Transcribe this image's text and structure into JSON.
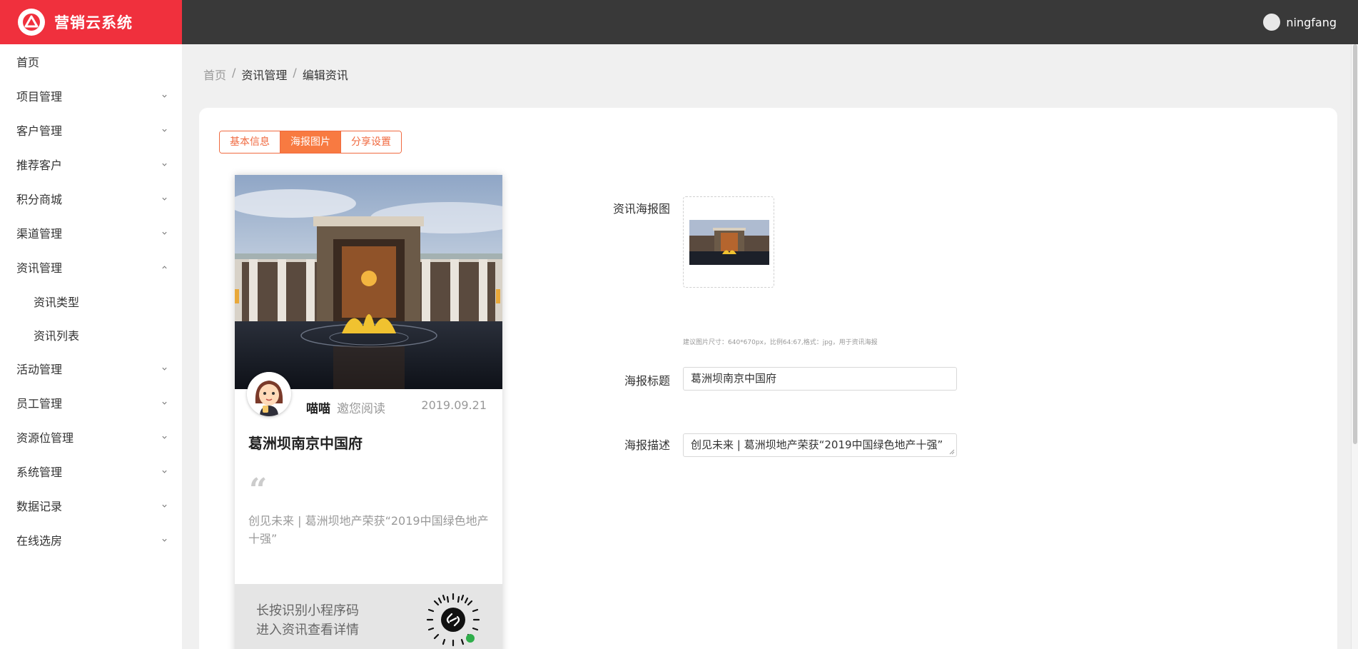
{
  "brand": {
    "title": "营销云系统",
    "color": "#f0303d"
  },
  "user": {
    "name": "ningfang"
  },
  "sidebar": {
    "items": [
      {
        "label": "首页",
        "expandable": false
      },
      {
        "label": "项目管理",
        "expandable": true
      },
      {
        "label": "客户管理",
        "expandable": true
      },
      {
        "label": "推荐客户",
        "expandable": true
      },
      {
        "label": "积分商城",
        "expandable": true
      },
      {
        "label": "渠道管理",
        "expandable": true
      },
      {
        "label": "资讯管理",
        "expandable": true,
        "expanded": true
      },
      {
        "label": "活动管理",
        "expandable": true
      },
      {
        "label": "员工管理",
        "expandable": true
      },
      {
        "label": "资源位管理",
        "expandable": true
      },
      {
        "label": "系统管理",
        "expandable": true
      },
      {
        "label": "数据记录",
        "expandable": true
      },
      {
        "label": "在线选房",
        "expandable": true
      }
    ],
    "sub_items": [
      "资讯类型",
      "资讯列表"
    ]
  },
  "breadcrumb": {
    "home": "首页",
    "section": "资讯管理",
    "current": "编辑资讯",
    "separator": "/"
  },
  "tabs": [
    {
      "label": "基本信息",
      "active": false
    },
    {
      "label": "海报图片",
      "active": true
    },
    {
      "label": "分享设置",
      "active": false
    }
  ],
  "accent_color": "#f87a41",
  "poster": {
    "author": "喵喵",
    "invite": "邀您阅读",
    "date": "2019.09.21",
    "title": "葛洲坝南京中国府",
    "quote_mark": "“",
    "description": "创见未来 | 葛洲坝地产荣获“2019中国绿色地产十强”",
    "footer_line1": "长按识别小程序码",
    "footer_line2": "进入资讯查看详情"
  },
  "form": {
    "poster_image_label": "资讯海报图",
    "hint": "建议图片尺寸：640*670px，比例64:67,格式：jpg，用于资讯海报",
    "poster_title_label": "海报标题",
    "poster_title_value": "葛洲坝南京中国府",
    "poster_desc_label": "海报描述",
    "poster_desc_value": "创见未来 | 葛洲坝地产荣获“2019中国绿色地产十强”"
  }
}
